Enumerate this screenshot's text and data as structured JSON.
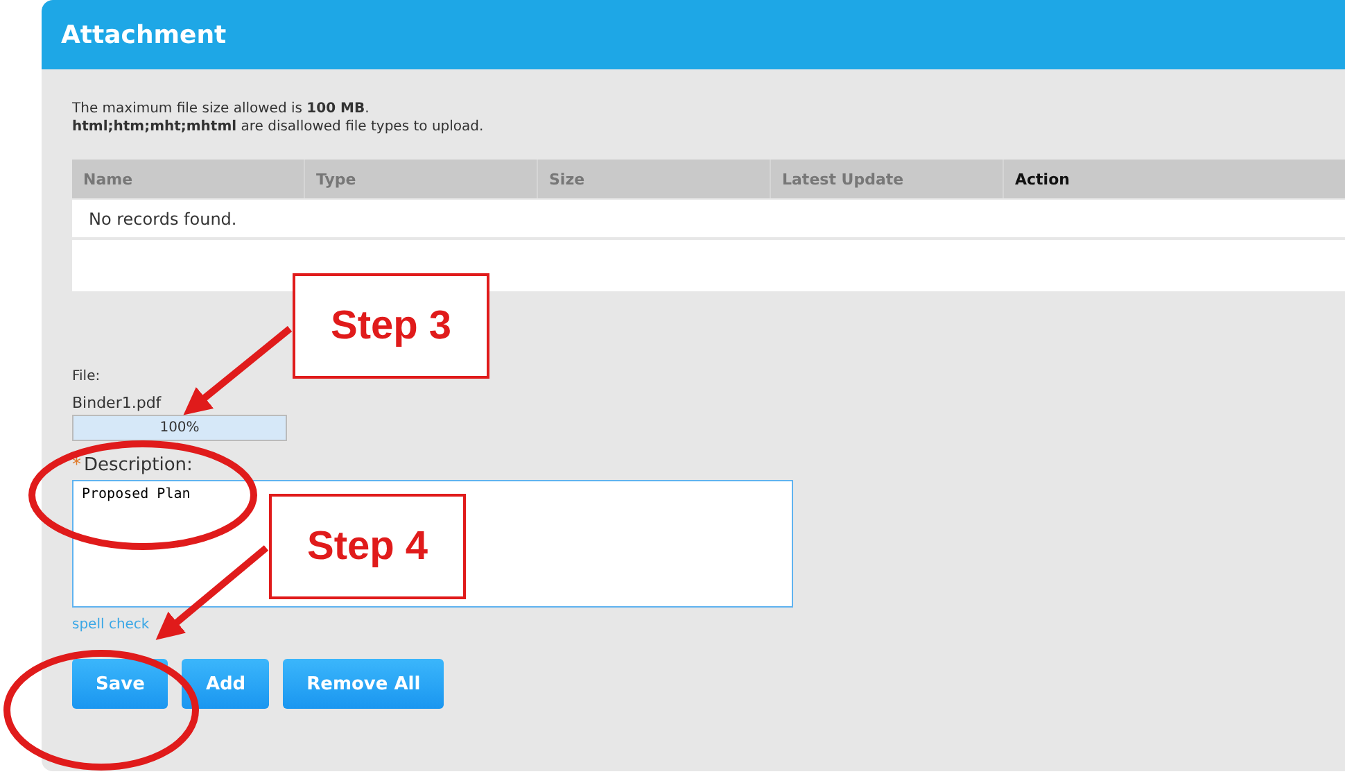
{
  "panel": {
    "title": "Attachment"
  },
  "notes": [
    "The maximum file size allowed is **100 MB**.",
    "**html;htm;mht;mhtml** are disallowed file types to upload."
  ],
  "table": {
    "columns": [
      {
        "label": "Name",
        "selected": false
      },
      {
        "label": "Type",
        "selected": false
      },
      {
        "label": "Size",
        "selected": false
      },
      {
        "label": "Latest Update",
        "selected": false
      },
      {
        "label": "Action",
        "selected": true
      }
    ],
    "empty_message": "No records found."
  },
  "file": {
    "label": "File:",
    "name": "Binder1.pdf",
    "progress": {
      "level": 1.0,
      "reading": "100%"
    }
  },
  "description": {
    "label": "Description:",
    "required_mark": "*",
    "value": "Proposed Plan"
  },
  "spell_check": "spell check",
  "buttons": [
    "Save",
    "Add",
    "Remove All"
  ],
  "callouts": [
    {
      "text": "Step 3"
    },
    {
      "text": "Step 4"
    }
  ]
}
